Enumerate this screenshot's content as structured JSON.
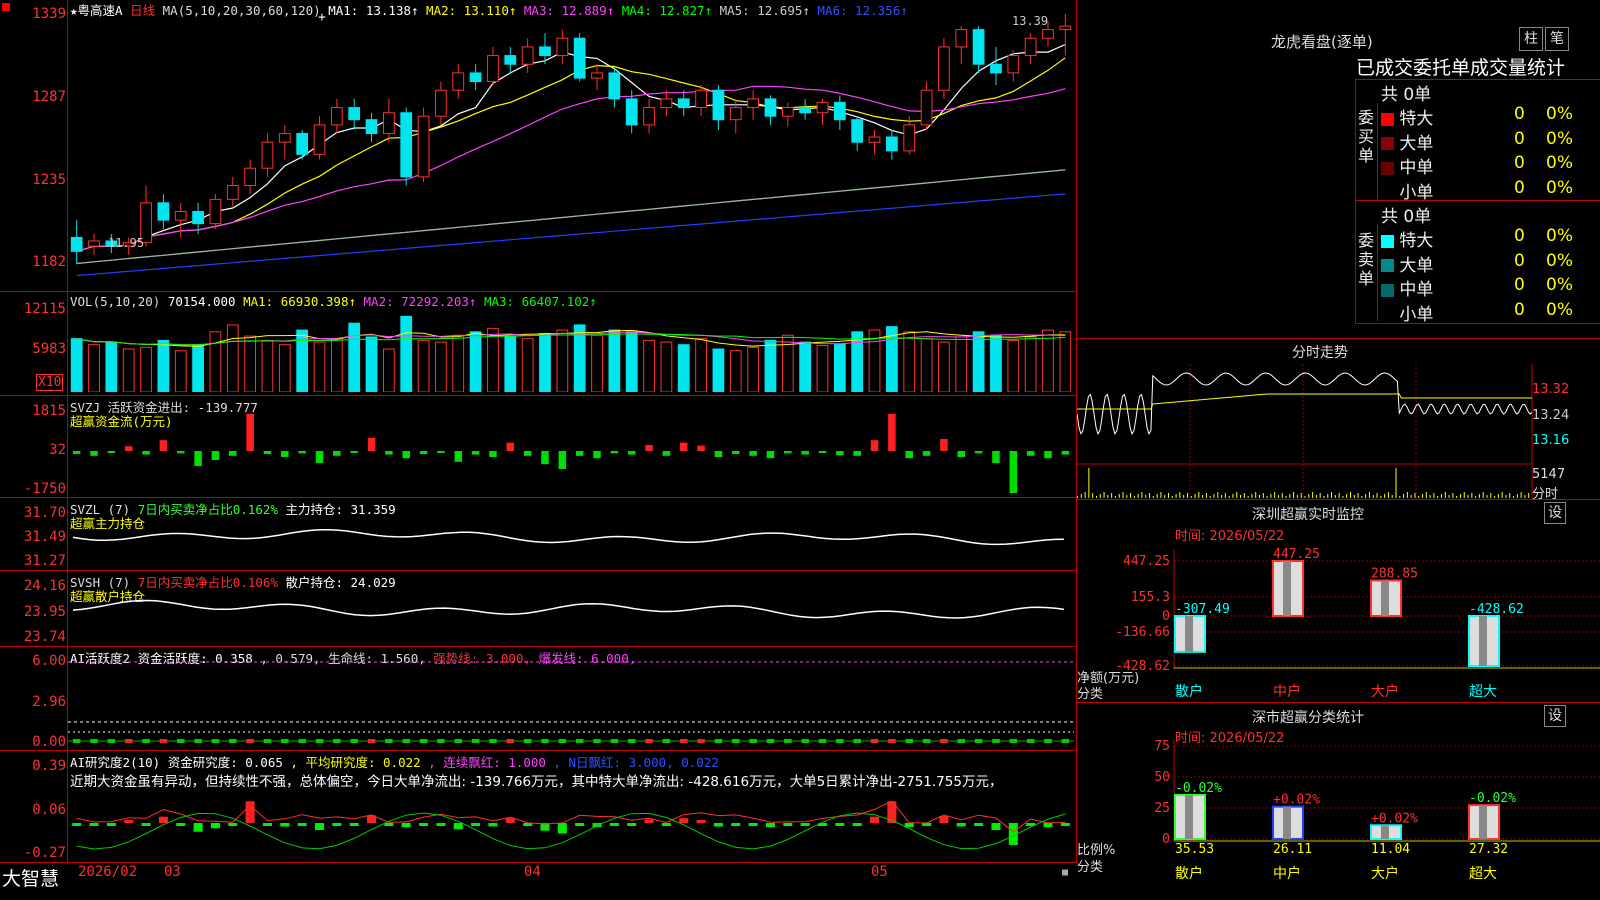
{
  "app": {
    "logo": "大智慧",
    "icon_marker": "red-square-icon"
  },
  "colors": {
    "up": "#ff3030",
    "down": "#00e5ee",
    "bg": "#000000",
    "grid": "#8b0000"
  },
  "kline": {
    "title": "★粤高速A",
    "period": "日线",
    "ma_header": "MA(5,10,20,30,60,120)",
    "ma_items": [
      {
        "label": "MA1: 13.138",
        "color": "#ffffff"
      },
      {
        "label": "MA2: 13.110",
        "color": "#ffff00"
      },
      {
        "label": "MA3: 12.889",
        "color": "#ff40ff"
      },
      {
        "label": "MA4: 12.827",
        "color": "#00ff00"
      },
      {
        "label": "MA5: 12.695",
        "color": "#cccccc"
      },
      {
        "label": "MA6: 12.356",
        "color": "#3050ff"
      }
    ],
    "yticks": [
      "1339",
      "1287",
      "1235",
      "1182"
    ],
    "high_label": "13.39",
    "low_label": "11.95"
  },
  "vol": {
    "header": "VOL(5,10,20)",
    "value": "70154.000",
    "ma_items": [
      {
        "label": "MA1: 66930.398",
        "color": "#ffff00"
      },
      {
        "label": "MA2: 72292.203",
        "color": "#ff40ff"
      },
      {
        "label": "MA3: 66407.102",
        "color": "#00ff00"
      }
    ],
    "yticks": [
      "12115",
      "5983"
    ],
    "unit": "X10"
  },
  "svzj": {
    "header": "SVZJ  活跃资金进出: -139.777",
    "sub": "超赢资金流(万元)",
    "yticks": [
      "1815",
      "32",
      "-1750"
    ]
  },
  "svzl": {
    "header_a": "SVZL (7)",
    "header_b": "7日内买卖净占比0.162%",
    "header_c": "主力持仓: 31.359",
    "sub": "超赢主力持仓",
    "yticks": [
      "31.70",
      "31.49",
      "31.27"
    ]
  },
  "svsh": {
    "header_a": "SVSH (7)",
    "header_b": "7日内买卖净占比0.106%",
    "header_c": "散户持仓: 24.029",
    "sub": "超赢散户持仓",
    "yticks": [
      "24.16",
      "23.95",
      "23.74"
    ]
  },
  "ai_active": {
    "header_a": "AI活跃度2 资金活跃度: 0.358",
    "header_b": ", 0.579, 生命线: 1.560,",
    "header_c": "强势线: 3.000,",
    "header_d": "爆发线: 6.000,",
    "yticks": [
      "6.00",
      "2.96",
      "0.00"
    ]
  },
  "ai_research": {
    "header_a": "AI研究度2(10) 资金研究度: 0.065",
    "header_b": ", 平均研究度: 0.022",
    "header_c": ", 连续飘红: 1.000",
    "header_d": ", N日飘红: 3.000, 0.022",
    "comment": "近期大资金虽有异动，但持续性不强，总体偏空，今日大单净流出: -139.766万元，其中特大单净流出: -428.616万元，大单5日累计净出-2751.755万元，",
    "yticks": [
      "0.39",
      "0.06",
      "-0.27"
    ]
  },
  "time_axis": {
    "labels": [
      "2026/02",
      "03",
      "04",
      "05"
    ]
  },
  "right": {
    "lhb_title": "龙虎看盘(逐单)",
    "btn_column": "柱",
    "btn_pen": "笔",
    "tabs": "已成交委托单成交量统计",
    "buy_title": "委买单",
    "sell_title": "委卖单",
    "buy_total": "共 0单",
    "sell_total": "共 0单",
    "buy_rows": [
      {
        "name": "特大",
        "count": "0",
        "pct": "0%",
        "color": "#ff0000"
      },
      {
        "name": "大单",
        "count": "0",
        "pct": "0%",
        "color": "#8b0000"
      },
      {
        "name": "中单",
        "count": "0",
        "pct": "0%",
        "color": "#6b0000"
      },
      {
        "name": "小单",
        "count": "0",
        "pct": "0%",
        "color": "#000000"
      }
    ],
    "sell_rows": [
      {
        "name": "特大",
        "count": "0",
        "pct": "0%",
        "color": "#00ffff"
      },
      {
        "name": "大单",
        "count": "0",
        "pct": "0%",
        "color": "#008b8b"
      },
      {
        "name": "中单",
        "count": "0",
        "pct": "0%",
        "color": "#006b6b"
      },
      {
        "name": "小单",
        "count": "0",
        "pct": "0%",
        "color": "#000000"
      }
    ],
    "intraday_title": "分时走势",
    "intraday_prices": [
      "13.32",
      "13.24",
      "13.16"
    ],
    "intraday_vol": "5147",
    "intraday_unit": "分时",
    "monitor_title": "深圳超赢实时监控",
    "monitor_time": "时间: 2026/05/22",
    "monitor_set": "设",
    "monitor_yticks": [
      "447.25",
      "155.3",
      "0",
      "-136.66",
      "-428.62"
    ],
    "monitor_ylabel": "净额(万元)",
    "monitor_xlabel": "分类",
    "monitor_bars": [
      {
        "cat": "散户",
        "value": -307.49,
        "label": "-307.49",
        "color": "#00ffff"
      },
      {
        "cat": "中户",
        "value": 447.25,
        "label": "447.25",
        "color": "#ff3030"
      },
      {
        "cat": "大户",
        "value": 288.85,
        "label": "288.85",
        "color": "#ff3030"
      },
      {
        "cat": "超大",
        "value": -428.62,
        "label": "-428.62",
        "color": "#00ffff"
      }
    ],
    "class_title": "深市超赢分类统计",
    "class_time": "时间: 2026/05/22",
    "class_set": "设",
    "class_yticks": [
      "75",
      "50",
      "25",
      "0"
    ],
    "class_ylabel": "比例%",
    "class_xlabel": "分类",
    "class_bars": [
      {
        "cat": "散户",
        "value": 35.53,
        "label": "35.53",
        "delta": "-0.02%",
        "color": "#30ff30"
      },
      {
        "cat": "中户",
        "value": 26.11,
        "label": "26.11",
        "delta": "+0.02%",
        "color": "#2040ff"
      },
      {
        "cat": "大户",
        "value": 11.04,
        "label": "11.04",
        "delta": "+0.02%",
        "color": "#00ffff"
      },
      {
        "cat": "超大",
        "value": 27.32,
        "label": "27.32",
        "delta": "-0.02%",
        "color": "#ff3030"
      }
    ]
  },
  "chart_data": {
    "type": "candlestick",
    "title": "★粤高速A 日线",
    "ylim": [
      11.82,
      13.39
    ],
    "candles": [
      [
        12.1,
        12.2,
        11.95,
        12.02
      ],
      [
        12.05,
        12.12,
        12.0,
        12.08
      ],
      [
        12.08,
        12.12,
        12.01,
        12.05
      ],
      [
        12.05,
        12.1,
        12.0,
        12.07
      ],
      [
        12.07,
        12.4,
        12.05,
        12.3
      ],
      [
        12.3,
        12.35,
        12.15,
        12.2
      ],
      [
        12.2,
        12.3,
        12.1,
        12.25
      ],
      [
        12.25,
        12.3,
        12.12,
        12.18
      ],
      [
        12.18,
        12.35,
        12.15,
        12.32
      ],
      [
        12.32,
        12.45,
        12.28,
        12.4
      ],
      [
        12.4,
        12.55,
        12.35,
        12.5
      ],
      [
        12.5,
        12.7,
        12.45,
        12.65
      ],
      [
        12.65,
        12.75,
        12.55,
        12.7
      ],
      [
        12.7,
        12.72,
        12.55,
        12.58
      ],
      [
        12.58,
        12.8,
        12.55,
        12.75
      ],
      [
        12.75,
        12.9,
        12.7,
        12.85
      ],
      [
        12.85,
        12.9,
        12.72,
        12.78
      ],
      [
        12.78,
        12.82,
        12.65,
        12.7
      ],
      [
        12.7,
        12.9,
        12.65,
        12.82
      ],
      [
        12.82,
        12.85,
        12.4,
        12.45
      ],
      [
        12.45,
        12.85,
        12.42,
        12.8
      ],
      [
        12.8,
        13.0,
        12.75,
        12.95
      ],
      [
        12.95,
        13.1,
        12.9,
        13.05
      ],
      [
        13.05,
        13.1,
        12.95,
        13.0
      ],
      [
        13.0,
        13.2,
        12.98,
        13.15
      ],
      [
        13.15,
        13.2,
        13.05,
        13.1
      ],
      [
        13.1,
        13.25,
        13.05,
        13.2
      ],
      [
        13.2,
        13.28,
        13.1,
        13.15
      ],
      [
        13.15,
        13.3,
        13.1,
        13.25
      ],
      [
        13.25,
        13.28,
        13.0,
        13.02
      ],
      [
        13.02,
        13.1,
        12.95,
        13.05
      ],
      [
        13.05,
        13.08,
        12.85,
        12.9
      ],
      [
        12.9,
        12.95,
        12.7,
        12.75
      ],
      [
        12.75,
        12.9,
        12.7,
        12.85
      ],
      [
        12.85,
        12.95,
        12.8,
        12.9
      ],
      [
        12.9,
        12.95,
        12.8,
        12.85
      ],
      [
        12.85,
        12.98,
        12.8,
        12.95
      ],
      [
        12.95,
        12.98,
        12.72,
        12.78
      ],
      [
        12.78,
        12.9,
        12.7,
        12.85
      ],
      [
        12.85,
        12.95,
        12.78,
        12.9
      ],
      [
        12.9,
        12.92,
        12.75,
        12.8
      ],
      [
        12.8,
        12.88,
        12.74,
        12.85
      ],
      [
        12.85,
        12.9,
        12.78,
        12.82
      ],
      [
        12.82,
        12.9,
        12.75,
        12.88
      ],
      [
        12.88,
        12.92,
        12.72,
        12.78
      ],
      [
        12.78,
        12.8,
        12.6,
        12.65
      ],
      [
        12.65,
        12.72,
        12.58,
        12.68
      ],
      [
        12.68,
        12.72,
        12.55,
        12.6
      ],
      [
        12.6,
        12.8,
        12.58,
        12.75
      ],
      [
        12.75,
        13.0,
        12.72,
        12.95
      ],
      [
        12.95,
        13.25,
        12.9,
        13.2
      ],
      [
        13.2,
        13.32,
        13.1,
        13.3
      ],
      [
        13.3,
        13.32,
        13.05,
        13.1
      ],
      [
        13.1,
        13.2,
        12.98,
        13.05
      ],
      [
        13.05,
        13.18,
        13.0,
        13.15
      ],
      [
        13.15,
        13.28,
        13.1,
        13.25
      ],
      [
        13.25,
        13.35,
        13.2,
        13.3
      ],
      [
        13.3,
        13.39,
        13.15,
        13.32
      ]
    ],
    "volume": [
      62,
      55,
      58,
      50,
      52,
      60,
      48,
      55,
      70,
      78,
      65,
      60,
      55,
      72,
      58,
      62,
      80,
      64,
      50,
      88,
      60,
      58,
      66,
      70,
      74,
      64,
      62,
      68,
      72,
      78,
      66,
      72,
      70,
      60,
      58,
      55,
      62,
      50,
      48,
      52,
      60,
      66,
      58,
      54,
      56,
      70,
      72,
      76,
      70,
      62,
      58,
      64,
      70,
      66,
      60,
      64,
      72,
      70
    ],
    "volume_ylim": [
      0,
      12115
    ],
    "flow": [
      -5,
      -8,
      -3,
      8,
      -6,
      18,
      -4,
      -25,
      -15,
      -8,
      62,
      -5,
      -10,
      -4,
      -20,
      -8,
      -3,
      22,
      -6,
      -12,
      -5,
      -3,
      -18,
      -6,
      -10,
      14,
      -8,
      -22,
      -30,
      -8,
      -12,
      -4,
      -6,
      10,
      -8,
      14,
      9,
      -10,
      -5,
      -8,
      -12,
      -4,
      -6,
      -3,
      -7,
      -8,
      18,
      62,
      -12,
      -8,
      20,
      -10,
      -4,
      -20,
      -70,
      -8,
      -12,
      -6
    ]
  }
}
